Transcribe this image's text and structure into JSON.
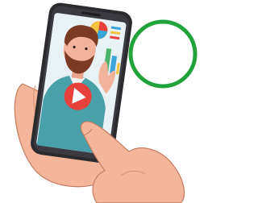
{
  "scene": {
    "subject": "hand-holding-smartphone-playing-video",
    "video": {
      "state": "paused",
      "play_button_icon": "play-triangle-icon"
    },
    "overlay_badge": {
      "shape": "circle-outline",
      "color": "#22a33a"
    }
  },
  "colors": {
    "phone_body": "#2b2b2f",
    "screen_bg": "#e8f1f4",
    "play_button": "#e8403a",
    "skin": "#f2b39a",
    "shirt": "#4aa0a8",
    "hair": "#7b3b22",
    "badge_ring": "#22a33a"
  }
}
